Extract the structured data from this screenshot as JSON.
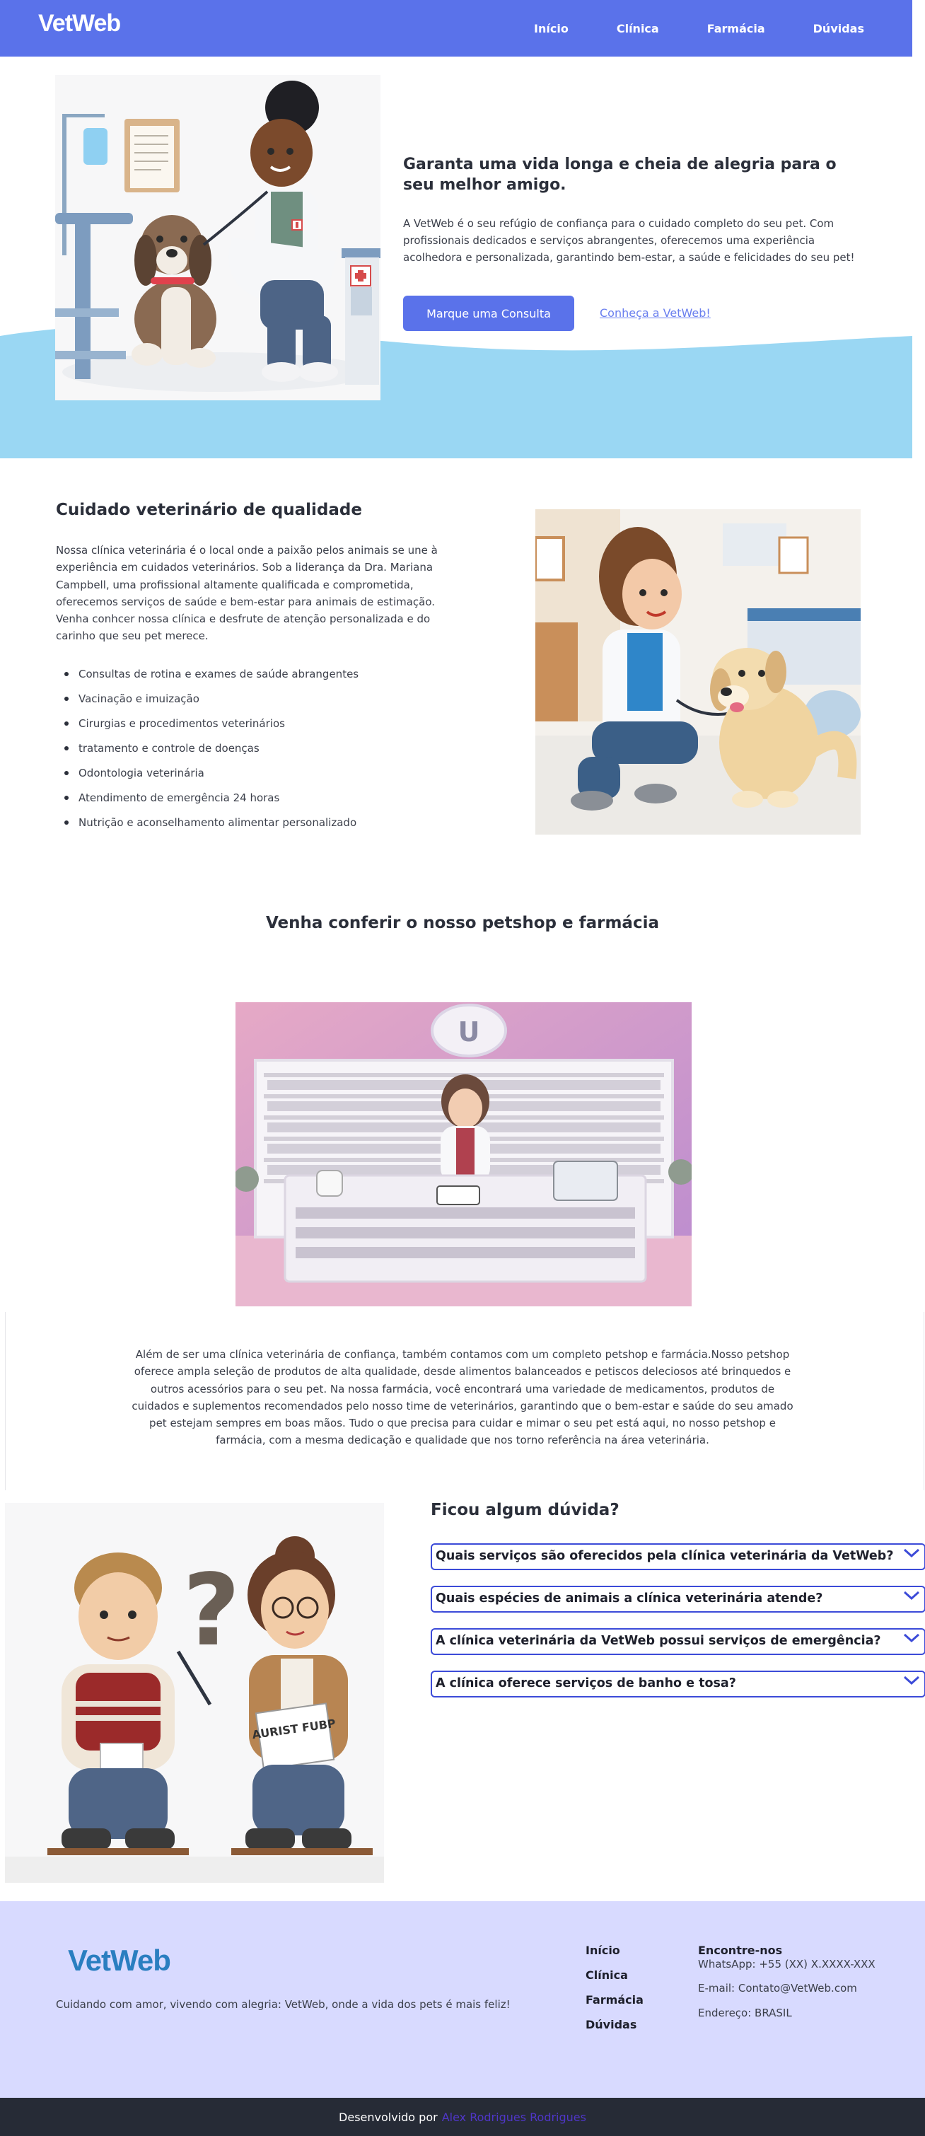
{
  "nav": {
    "logo": "VetWeb",
    "links": [
      "Início",
      "Clínica",
      "Farmácia",
      "Dúvidas"
    ]
  },
  "hero": {
    "title": "Garanta uma vida longa e cheia de alegria para o seu melhor amigo.",
    "text": "A VetWeb é o seu refúgio de confiança para o cuidado completo do seu pet. Com profissionais dedicados e serviços abrangentes, oferecemos uma experiência acolhedora e personalizada, garantindo bem-estar, a saúde e felicidades do seu pet!",
    "primary_button": "Marque uma Consulta",
    "secondary_link": "Conheça a VetWeb!"
  },
  "quality": {
    "title": "Cuidado veterinário de qualidade",
    "text": "Nossa clínica veterinária é o local onde a paixão pelos animais se une à experiência em cuidados veterinários. Sob a liderança da Dra. Mariana Campbell, uma profissional altamente qualificada e comprometida, oferecemos serviços de saúde e bem-estar para animais de estimação. Venha conhcer nossa clínica e desfrute de atenção personalizada e do carinho que seu pet merece.",
    "services": [
      "Consultas de rotina e exames de saúde abrangentes",
      "Vacinação e imuização",
      "Cirurgias e procedimentos veterinários",
      "tratamento e controle de doenças",
      "Odontologia veterinária",
      "Atendimento de emergência 24 horas",
      "Nutrição e aconselhamento alimentar personalizado"
    ]
  },
  "petshop": {
    "title": "Venha conferir o nosso petshop e farmácia",
    "sign_letter": "U",
    "text": "Além de ser uma clínica veterinária de confiança, também contamos com um completo petshop e farmácia.Nosso petshop oferece ampla seleção de produtos de alta qualidade, desde alimentos balanceados e petiscos deleciosos até brinquedos e outros acessórios para o seu pet. Na nossa farmácia, você encontrará uma variedade de medicamentos, produtos de cuidados e suplementos recomendados pelo nosso time de veterinários, garantindo que o bem-estar e saúde do seu amado pet estejam sempres em boas mãos. Tudo o que precisa para cuidar e mimar o seu pet está aqui, no nosso petshop e farmácia, com a mesma dedicação e qualidade que nos torno referência na área veterinária."
  },
  "faq": {
    "title": "Ficou algum dúvida?",
    "book_text": "AURIST FUBP",
    "questions": [
      "Quais serviços são oferecidos pela clínica veterinária da VetWeb?",
      "Quais espécies de animais a clínica veterinária atende?",
      "A clínica veterinária da VetWeb possui serviços de emergência?",
      "A clínica oferece serviços de banho e tosa?"
    ]
  },
  "footer": {
    "logo": "VetWeb",
    "tagline": "Cuidando com amor, vivendo com alegria: VetWeb, onde a vida dos pets é mais feliz!",
    "links": [
      "Início",
      "Clínica",
      "Farmácia",
      "Dúvidas"
    ],
    "contact_title": "Encontre-nos",
    "whatsapp": "WhatsApp: +55 (XX) X.XXXX-XXX",
    "email": "E-mail: Contato@VetWeb.com",
    "address": "Endereço: BRASIL"
  },
  "bottom_bar": {
    "developed_by": "Desenvolvido por",
    "developer": "Alex Rodrigues Rodrigues"
  },
  "colors": {
    "nav": "#5a72ea",
    "wave": "#9ad7f3",
    "footer": "#d8daff",
    "bottom": "#262b36",
    "faq_border": "#3c4bd8"
  }
}
